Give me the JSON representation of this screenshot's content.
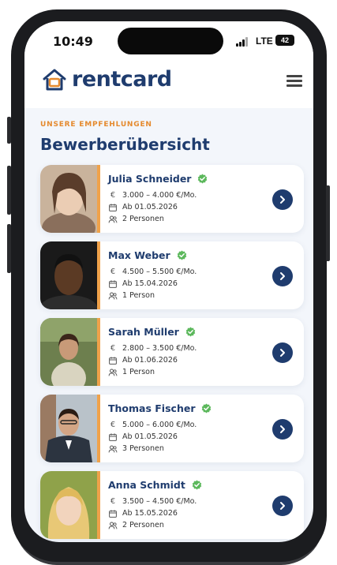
{
  "status_bar": {
    "time": "10:49",
    "network": "LTE",
    "battery": "42"
  },
  "header": {
    "logo_text": "rentcard",
    "menu_icon": "hamburger-menu-icon"
  },
  "section": {
    "eyebrow": "UNSERE EMPFEHLUNGEN",
    "title": "Bewerberübersicht"
  },
  "colors": {
    "brand": "#1f3c6e",
    "accent": "#e58a2e",
    "verified": "#5cb85c"
  },
  "applicants": [
    {
      "name": "Julia Schneider",
      "budget": "3.000 – 4.000 €/Mo.",
      "move_in": "Ab 01.05.2026",
      "persons": "2 Personen"
    },
    {
      "name": "Max Weber",
      "budget": "4.500 – 5.500 €/Mo.",
      "move_in": "Ab 15.04.2026",
      "persons": "1 Person"
    },
    {
      "name": "Sarah Müller",
      "budget": "2.800 – 3.500 €/Mo.",
      "move_in": "Ab 01.06.2026",
      "persons": "1 Person"
    },
    {
      "name": "Thomas Fischer",
      "budget": "5.000 – 6.000 €/Mo.",
      "move_in": "Ab 01.05.2026",
      "persons": "3 Personen"
    },
    {
      "name": "Anna Schmidt",
      "budget": "3.500 – 4.500 €/Mo.",
      "move_in": "Ab 15.05.2026",
      "persons": "2 Personen"
    }
  ]
}
